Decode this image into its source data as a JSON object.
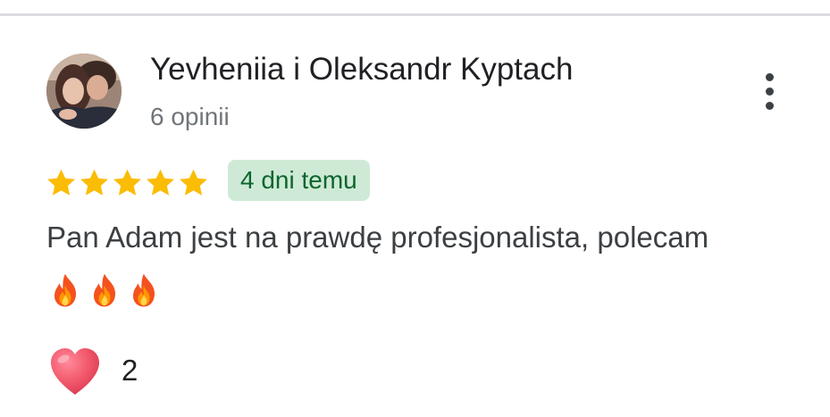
{
  "review": {
    "author_name": "Yevheniia i Oleksandr Kyptach",
    "author_review_count": "6 opinii",
    "rating": 5,
    "rating_max": 5,
    "date": "4 dni temu",
    "text": "Pan Adam jest na prawdę profesjonalista, polecam",
    "emoji": [
      "fire-icon",
      "fire-icon",
      "fire-icon"
    ],
    "reaction_icon": "heart-icon",
    "reaction_count": "2"
  },
  "menu": {
    "icon": "more-vertical-icon"
  },
  "colors": {
    "star": "#FBBC04",
    "badge_bg": "#CEEAD6",
    "badge_text": "#0D652D",
    "heart": "#F1566A",
    "secondary_text": "#70757A"
  }
}
